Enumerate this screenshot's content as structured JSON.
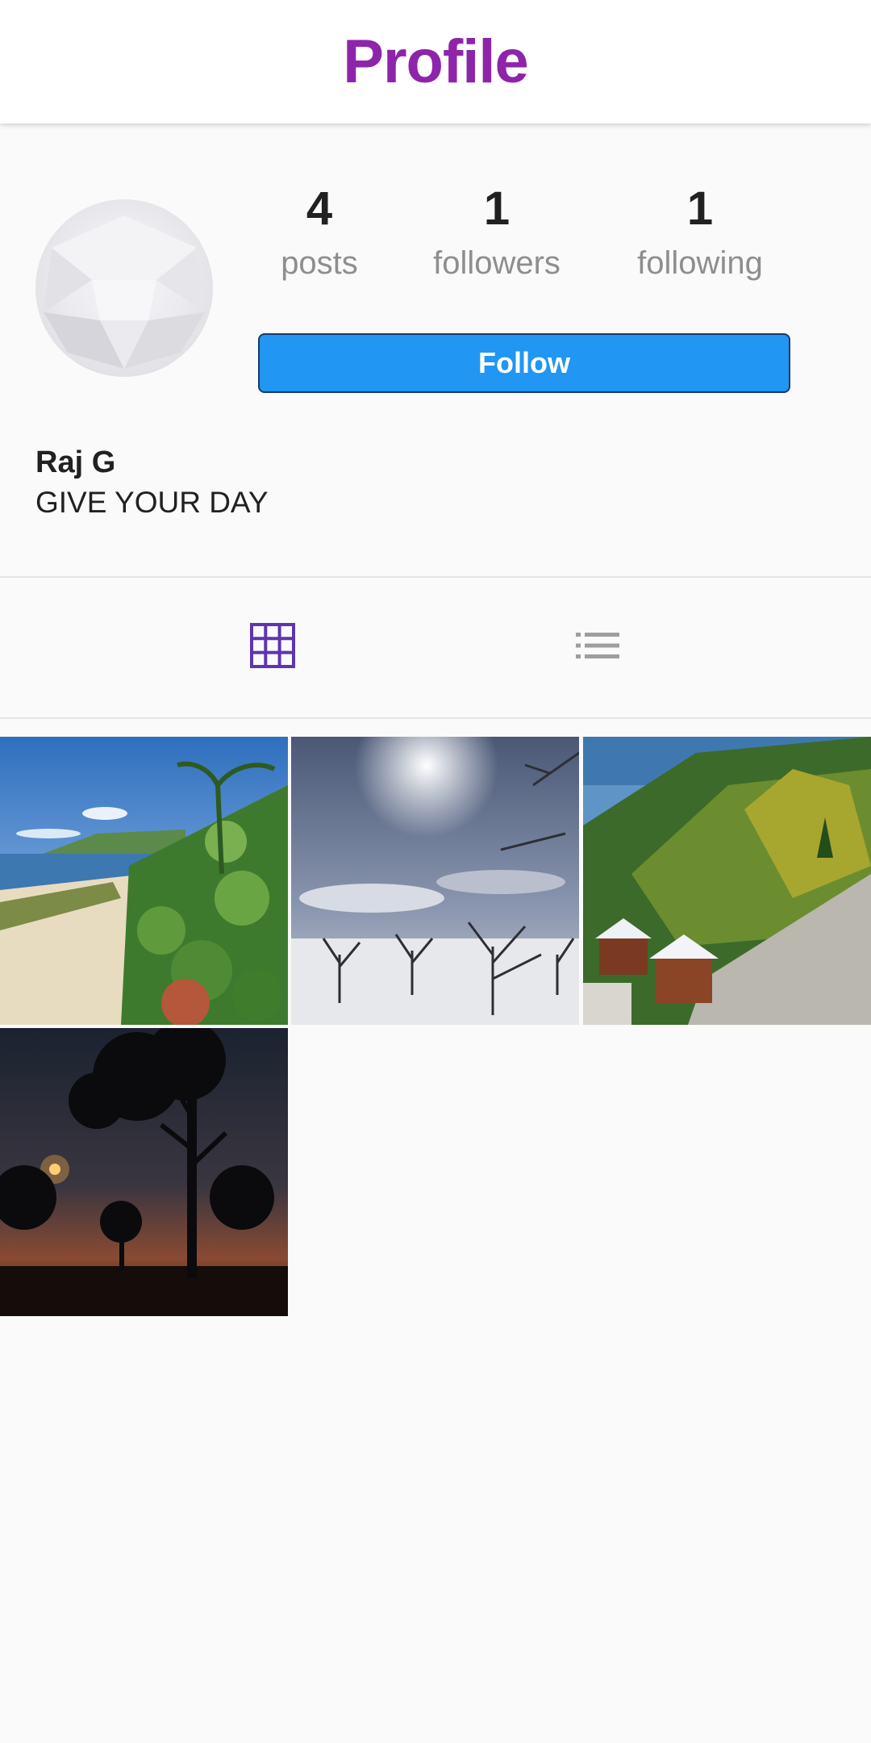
{
  "app_bar": {
    "title": "Profile"
  },
  "profile": {
    "avatar_icon": "avatar-placeholder",
    "stats": [
      {
        "value": "4",
        "label": "posts"
      },
      {
        "value": "1",
        "label": "followers"
      },
      {
        "value": "1",
        "label": "following"
      }
    ],
    "follow_label": "Follow",
    "name": "Raj G",
    "bio": "GIVE YOUR DAY"
  },
  "tabs": [
    {
      "icon": "grid-icon",
      "active": true
    },
    {
      "icon": "list-icon",
      "active": false
    }
  ],
  "posts": [
    {
      "scene": "beach"
    },
    {
      "scene": "snow-orchard"
    },
    {
      "scene": "mountain-village"
    },
    {
      "scene": "sunset-trees"
    }
  ],
  "colors": {
    "accent": "#8e24aa",
    "follow_button": "#2196f3",
    "tab_active": "#5e35b1",
    "tab_inactive": "#9e9e9e"
  }
}
